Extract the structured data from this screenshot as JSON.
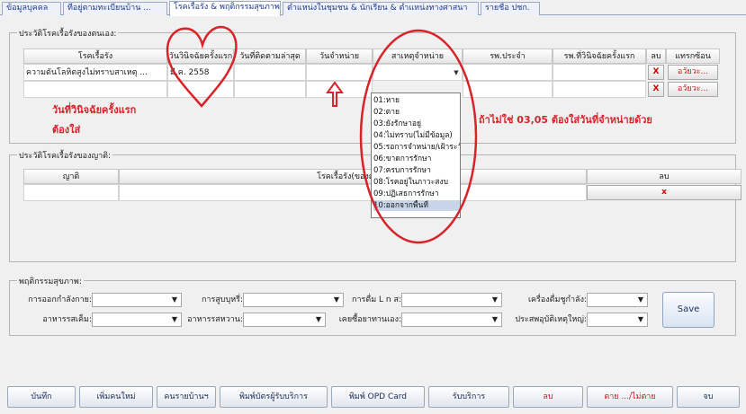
{
  "tabs": [
    {
      "label": "ข้อมูลบุคคล"
    },
    {
      "label": "ที่อยู่ตามทะเบียนบ้าน ..."
    },
    {
      "label": "โรคเรื้อรัง & พฤติกรรมสุขภาพ"
    },
    {
      "label": "ตำแหน่งในชุมชน & นักเรียน & ตำแหน่งทางศาสนา"
    },
    {
      "label": "รายชื่อ ปชก."
    }
  ],
  "chronic": {
    "title": "ประวัติโรคเรื้อรังของตนเอง:",
    "columns": [
      "โรคเรื้อรัง",
      "วันวินิจฉัยครั้งแรก",
      "วันที่ติดตามล่าสุด",
      "วันจำหน่าย",
      "สาเหตุจำหน่าย",
      "รพ.ประจำ",
      "รพ.ที่วินิจฉัยครั้งแรก",
      "ลบ",
      "แทรกซ้อน"
    ],
    "rows": [
      {
        "disease": "ความดันโลหิตสูงไม่ทราบสาเหตุ ...",
        "diag_date": "มี.ค. 2558",
        "delete": "X",
        "more": "อวัยวะ..."
      },
      {
        "disease": "",
        "diag_date": "",
        "delete": "X",
        "more": "อวัยวะ..."
      }
    ]
  },
  "discharge_options": [
    "01:หาย",
    "02:ตาย",
    "03:ยังรักษาอยู่",
    "04:ไม่ทราบ(ไม่มีข้อมูล)",
    "05:รอการจำหน่าย/เฝ้าระวัง",
    "06:ขาดการรักษา",
    "07:ครบการรักษา",
    "08:โรคอยู่ในภาวะสงบ",
    "09:ปฏิเสธการรักษา",
    "10:ออกจากพื้นที่"
  ],
  "annotations": {
    "left_line1": "วันที่วินิจฉัยครั้งแรก",
    "left_line2": "ต้องใส่",
    "right": "ถ้าไม่ใช่  03,05 ต้องใส่วันที่จำหน่ายด้วย",
    "color": "#d8232a"
  },
  "relatives": {
    "title": "ประวัติโรคเรื้อรังของญาติ:",
    "columns": [
      "ญาติ",
      "โรคเรื้อรัง(ของญาติ)",
      "ลบ"
    ],
    "row_delete": "x"
  },
  "health": {
    "title": "พฤติกรรมสุขภาพ:",
    "fields": [
      {
        "label": "การออกกำลังกาย:"
      },
      {
        "label": "การสูบบุหรี่:"
      },
      {
        "label": "การดื่ม L n ส:"
      },
      {
        "label": "เครื่องดื่มชูกำลัง:"
      },
      {
        "label": "อาหารรสเค็ม:"
      },
      {
        "label": "อาหารรสหวาน:"
      },
      {
        "label": "เคยซื้อยาทานเอง:"
      },
      {
        "label": "ประสพอุบัติเหตุใหญ่:"
      }
    ],
    "save_label": "Save"
  },
  "bottom_buttons": [
    {
      "label": "บันทึก"
    },
    {
      "label": "เพิ่มคนใหม่"
    },
    {
      "label": "คนรายบ้านฯ"
    },
    {
      "label": "พิมพ์บัตรผู้รับบริการ"
    },
    {
      "label": "พิมพ์ OPD Card"
    },
    {
      "label": "รับบริการ"
    },
    {
      "label": "ลบ"
    },
    {
      "label": "ตาย .../ไม่ตาย"
    },
    {
      "label": "จบ"
    }
  ],
  "colors": {
    "accent_red": "#d8232a",
    "tab_text": "#1f3a93"
  }
}
